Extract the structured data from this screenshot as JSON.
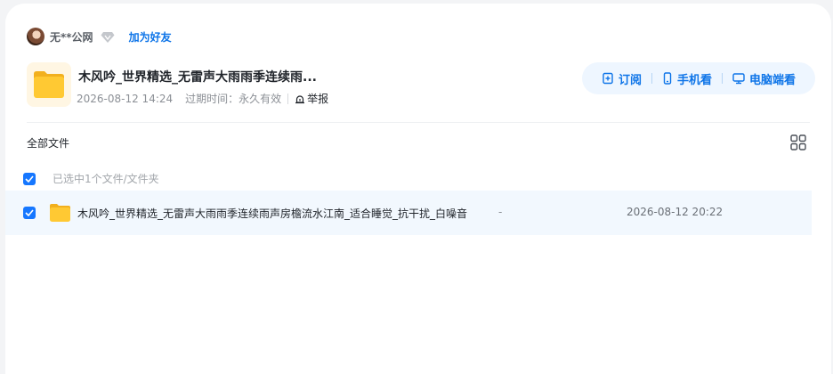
{
  "user": {
    "name": "无**公网",
    "add_friend": "加为好友"
  },
  "share": {
    "title": "木风吟_世界精选_无雷声大雨雨季连续雨...",
    "created": "2026-08-12 14:24",
    "expire_label": "过期时间：",
    "expire_value": "永久有效",
    "report": "举报"
  },
  "actions": {
    "subscribe": "订阅",
    "mobile": "手机看",
    "desktop": "电脑端看"
  },
  "files_header": {
    "title": "全部文件",
    "selected_text": "已选中1个文件/文件夹"
  },
  "files": [
    {
      "name": "木风吟_世界精选_无雷声大雨雨季连续雨声房檐流水江南_适合睡觉_抗干扰_白噪音",
      "size": "-",
      "date": "2026-08-12 20:22"
    }
  ],
  "colors": {
    "accent": "#0d74e8",
    "checkbox": "#1677ff",
    "selected_row": "#f2f8fe",
    "folder": "#ffc933"
  }
}
